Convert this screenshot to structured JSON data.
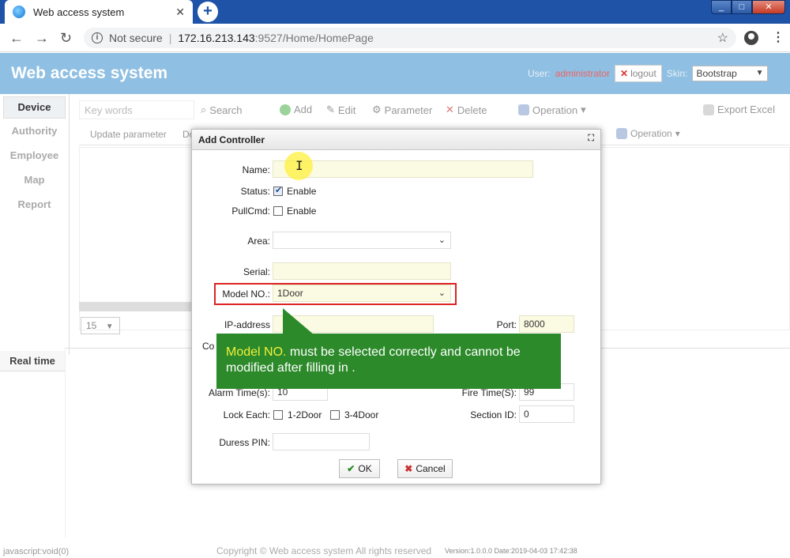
{
  "browser": {
    "tab_title": "Web access system",
    "tab_close": "✕",
    "new_tab": "+",
    "not_secure": "Not secure",
    "url_host": "172.16.213.143",
    "url_path": ":9527/Home/HomePage"
  },
  "header": {
    "title": "Web access system",
    "user_label": "User:",
    "user_name": "administrator",
    "logout_label": "logout",
    "skin_label": "Skin:",
    "skin_value": "Bootstrap"
  },
  "sidebar": {
    "items": [
      {
        "label": "Device"
      },
      {
        "label": "Authority"
      },
      {
        "label": "Employee"
      },
      {
        "label": "Map"
      },
      {
        "label": "Report"
      }
    ],
    "realtime": "Real time"
  },
  "toolbar": {
    "search_placeholder": "Key words",
    "search": "Search",
    "add": "Add",
    "edit": "Edit",
    "parameter": "Parameter",
    "delete": "Delete",
    "operation": "Operation",
    "export": "Export Excel"
  },
  "subbar": {
    "update_parameter": "Update parameter",
    "truncated": "Do",
    "operation": "Operation"
  },
  "pager": {
    "page_size": "15"
  },
  "dialog": {
    "title": "Add Controller",
    "name_label": "Name:",
    "name_value": "",
    "status_label": "Status:",
    "status_enable": "Enable",
    "pullcmd_label": "PullCmd:",
    "pullcmd_enable": "Enable",
    "area_label": "Area:",
    "area_value": "",
    "serial_label": "Serial:",
    "serial_value": "",
    "model_label": "Model NO.:",
    "model_value": "1Door",
    "ip_label": "IP-address",
    "port_label": "Port:",
    "port_value": "8000",
    "co_label": "Co",
    "alarm_label": "Alarm Time(s):",
    "alarm_value": "10",
    "fire_label": "Fire Time(S):",
    "fire_value": "99",
    "lock_label": "Lock Each:",
    "lock_opt1": "1-2Door",
    "lock_opt2": "3-4Door",
    "section_label": "Section ID:",
    "section_value": "0",
    "duress_label": "Duress PIN:",
    "duress_value": "",
    "ok": "OK",
    "cancel": "Cancel"
  },
  "callout": {
    "highlight": "Model NO.",
    "text": " must be selected correctly and cannot be modified after filling in ."
  },
  "footer": {
    "status_url": "javascript:void(0)",
    "copyright": "Copyright © Web access system All rights reserved",
    "version": "Version:1.0.0.0 Date:2019-04-03 17:42:38"
  },
  "colors": {
    "tabbar": "#1e53a8",
    "app_header": "#8fbfe2",
    "callout": "#2c8a2a",
    "callout_highlight": "#f2ef3b",
    "highlight_box": "#dd2222"
  }
}
